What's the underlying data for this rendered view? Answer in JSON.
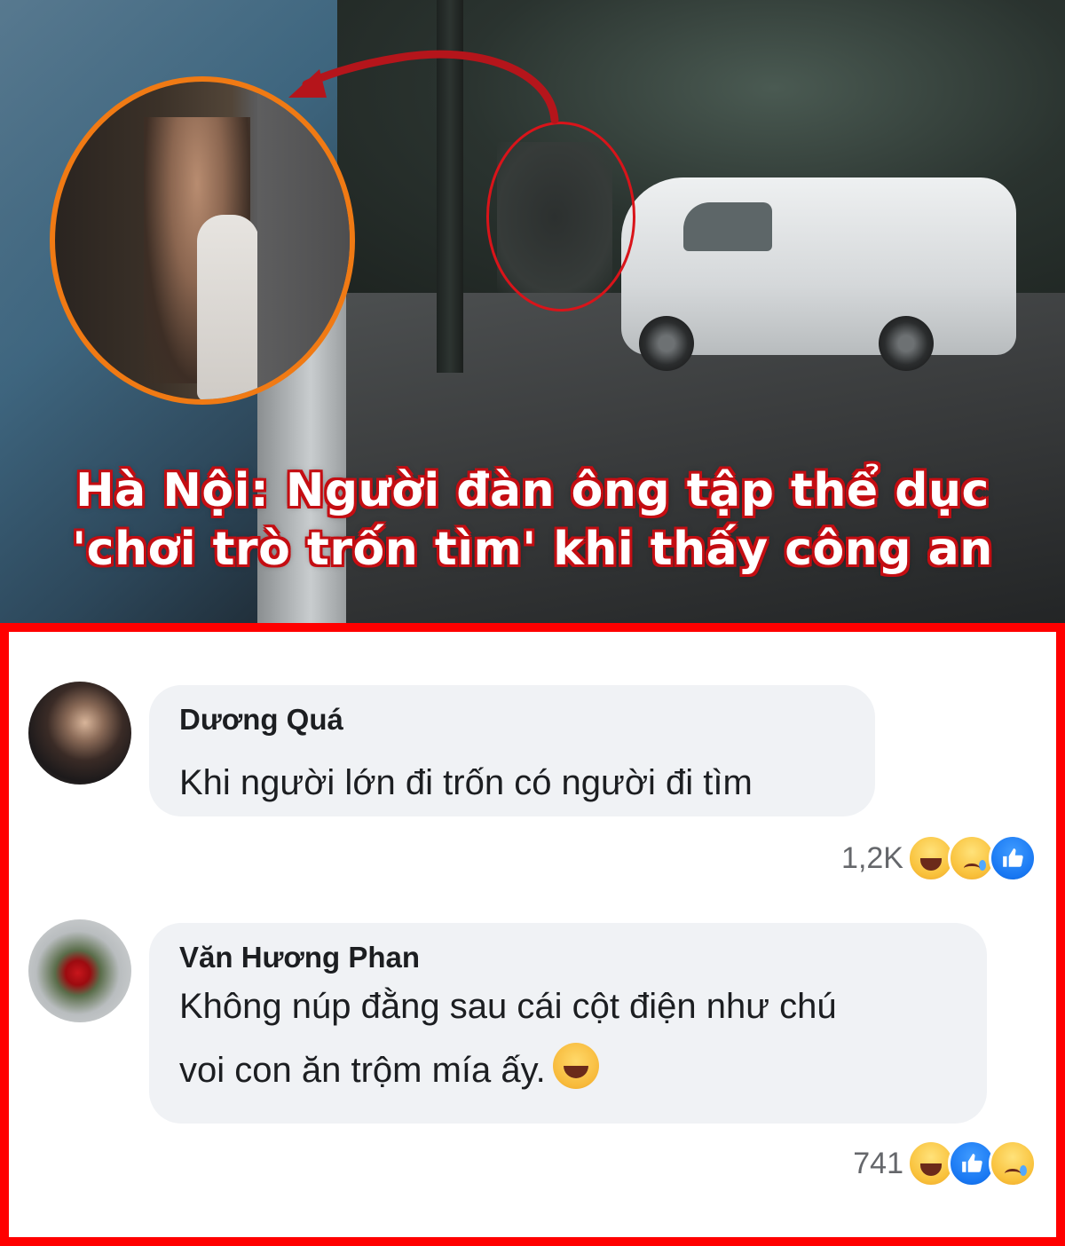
{
  "headline": {
    "line1": "Hà Nội: Người đàn ông tập thể dục",
    "line2": "'chơi trò trốn tìm' khi thấy công an"
  },
  "colors": {
    "headline_outline": "#c40d12",
    "panel_border": "#ff0000",
    "highlight_ring_orange": "#f07a14",
    "highlight_ring_red": "#d9141a",
    "bubble_bg": "#f0f2f5",
    "like_blue": "#1877f2"
  },
  "comments": [
    {
      "author": "Dương Quá",
      "text": "Khi người lớn đi trốn có người đi tìm",
      "reaction_count": "1,2K",
      "reactions": [
        "haha-icon",
        "sad-icon",
        "like-icon"
      ]
    },
    {
      "author": "Văn Hương Phan",
      "text_line1": "Không núp đằng sau cái cột điện như chú",
      "text_line2": "voi con ăn trộm mía ấy.",
      "reaction_count": "741",
      "reactions": [
        "haha-icon",
        "like-icon",
        "sad-icon"
      ]
    }
  ]
}
